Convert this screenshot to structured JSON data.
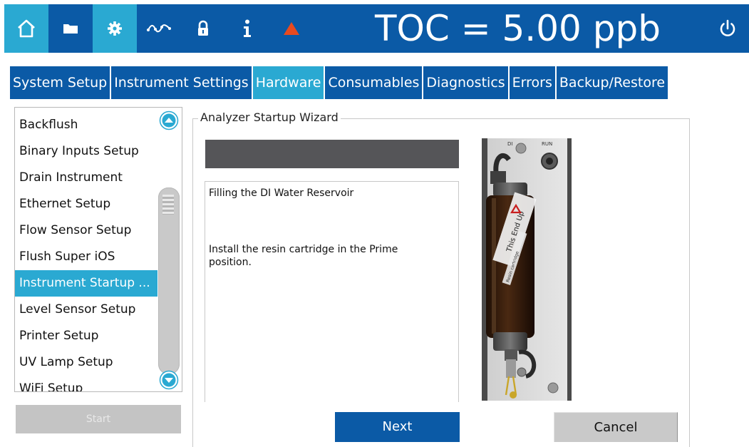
{
  "header": {
    "icons": [
      "home-icon",
      "folder-icon",
      "gear-icon",
      "trend-icon",
      "lock-icon",
      "info-icon",
      "warning-icon",
      "power-icon"
    ],
    "title": "TOC = 5.00 ppb"
  },
  "tabs": [
    {
      "label": "System Setup"
    },
    {
      "label": "Instrument Settings"
    },
    {
      "label": "Hardware"
    },
    {
      "label": "Consumables"
    },
    {
      "label": "Diagnostics"
    },
    {
      "label": "Errors"
    },
    {
      "label": "Backup/Restore"
    }
  ],
  "sidebar": {
    "items": [
      {
        "label": "Backflush"
      },
      {
        "label": "Binary Inputs Setup"
      },
      {
        "label": "Drain Instrument"
      },
      {
        "label": "Ethernet Setup"
      },
      {
        "label": "Flow Sensor Setup"
      },
      {
        "label": "Flush Super iOS"
      },
      {
        "label": "Instrument Startup ..."
      },
      {
        "label": "Level Sensor Setup"
      },
      {
        "label": "Printer Setup"
      },
      {
        "label": "UV Lamp Setup"
      },
      {
        "label": "WiFi Setup"
      }
    ],
    "selected_index": 6,
    "action_label": "Start"
  },
  "wizard": {
    "title": "Analyzer Startup Wizard",
    "heading": "Filling the DI Water Reservoir",
    "instruction": "Install the resin cartridge in the Prime position.",
    "photo_labels": {
      "port_left": "DI",
      "port_right": "RUN",
      "cartridge": "This End Up",
      "sticker": "Resin cartridge"
    },
    "next_label": "Next",
    "cancel_label": "Cancel"
  },
  "colors": {
    "primary": "#0b5aa6",
    "accent": "#2aa9d2",
    "warning": "#e84a1f",
    "button_gray": "#c9c9c9"
  }
}
